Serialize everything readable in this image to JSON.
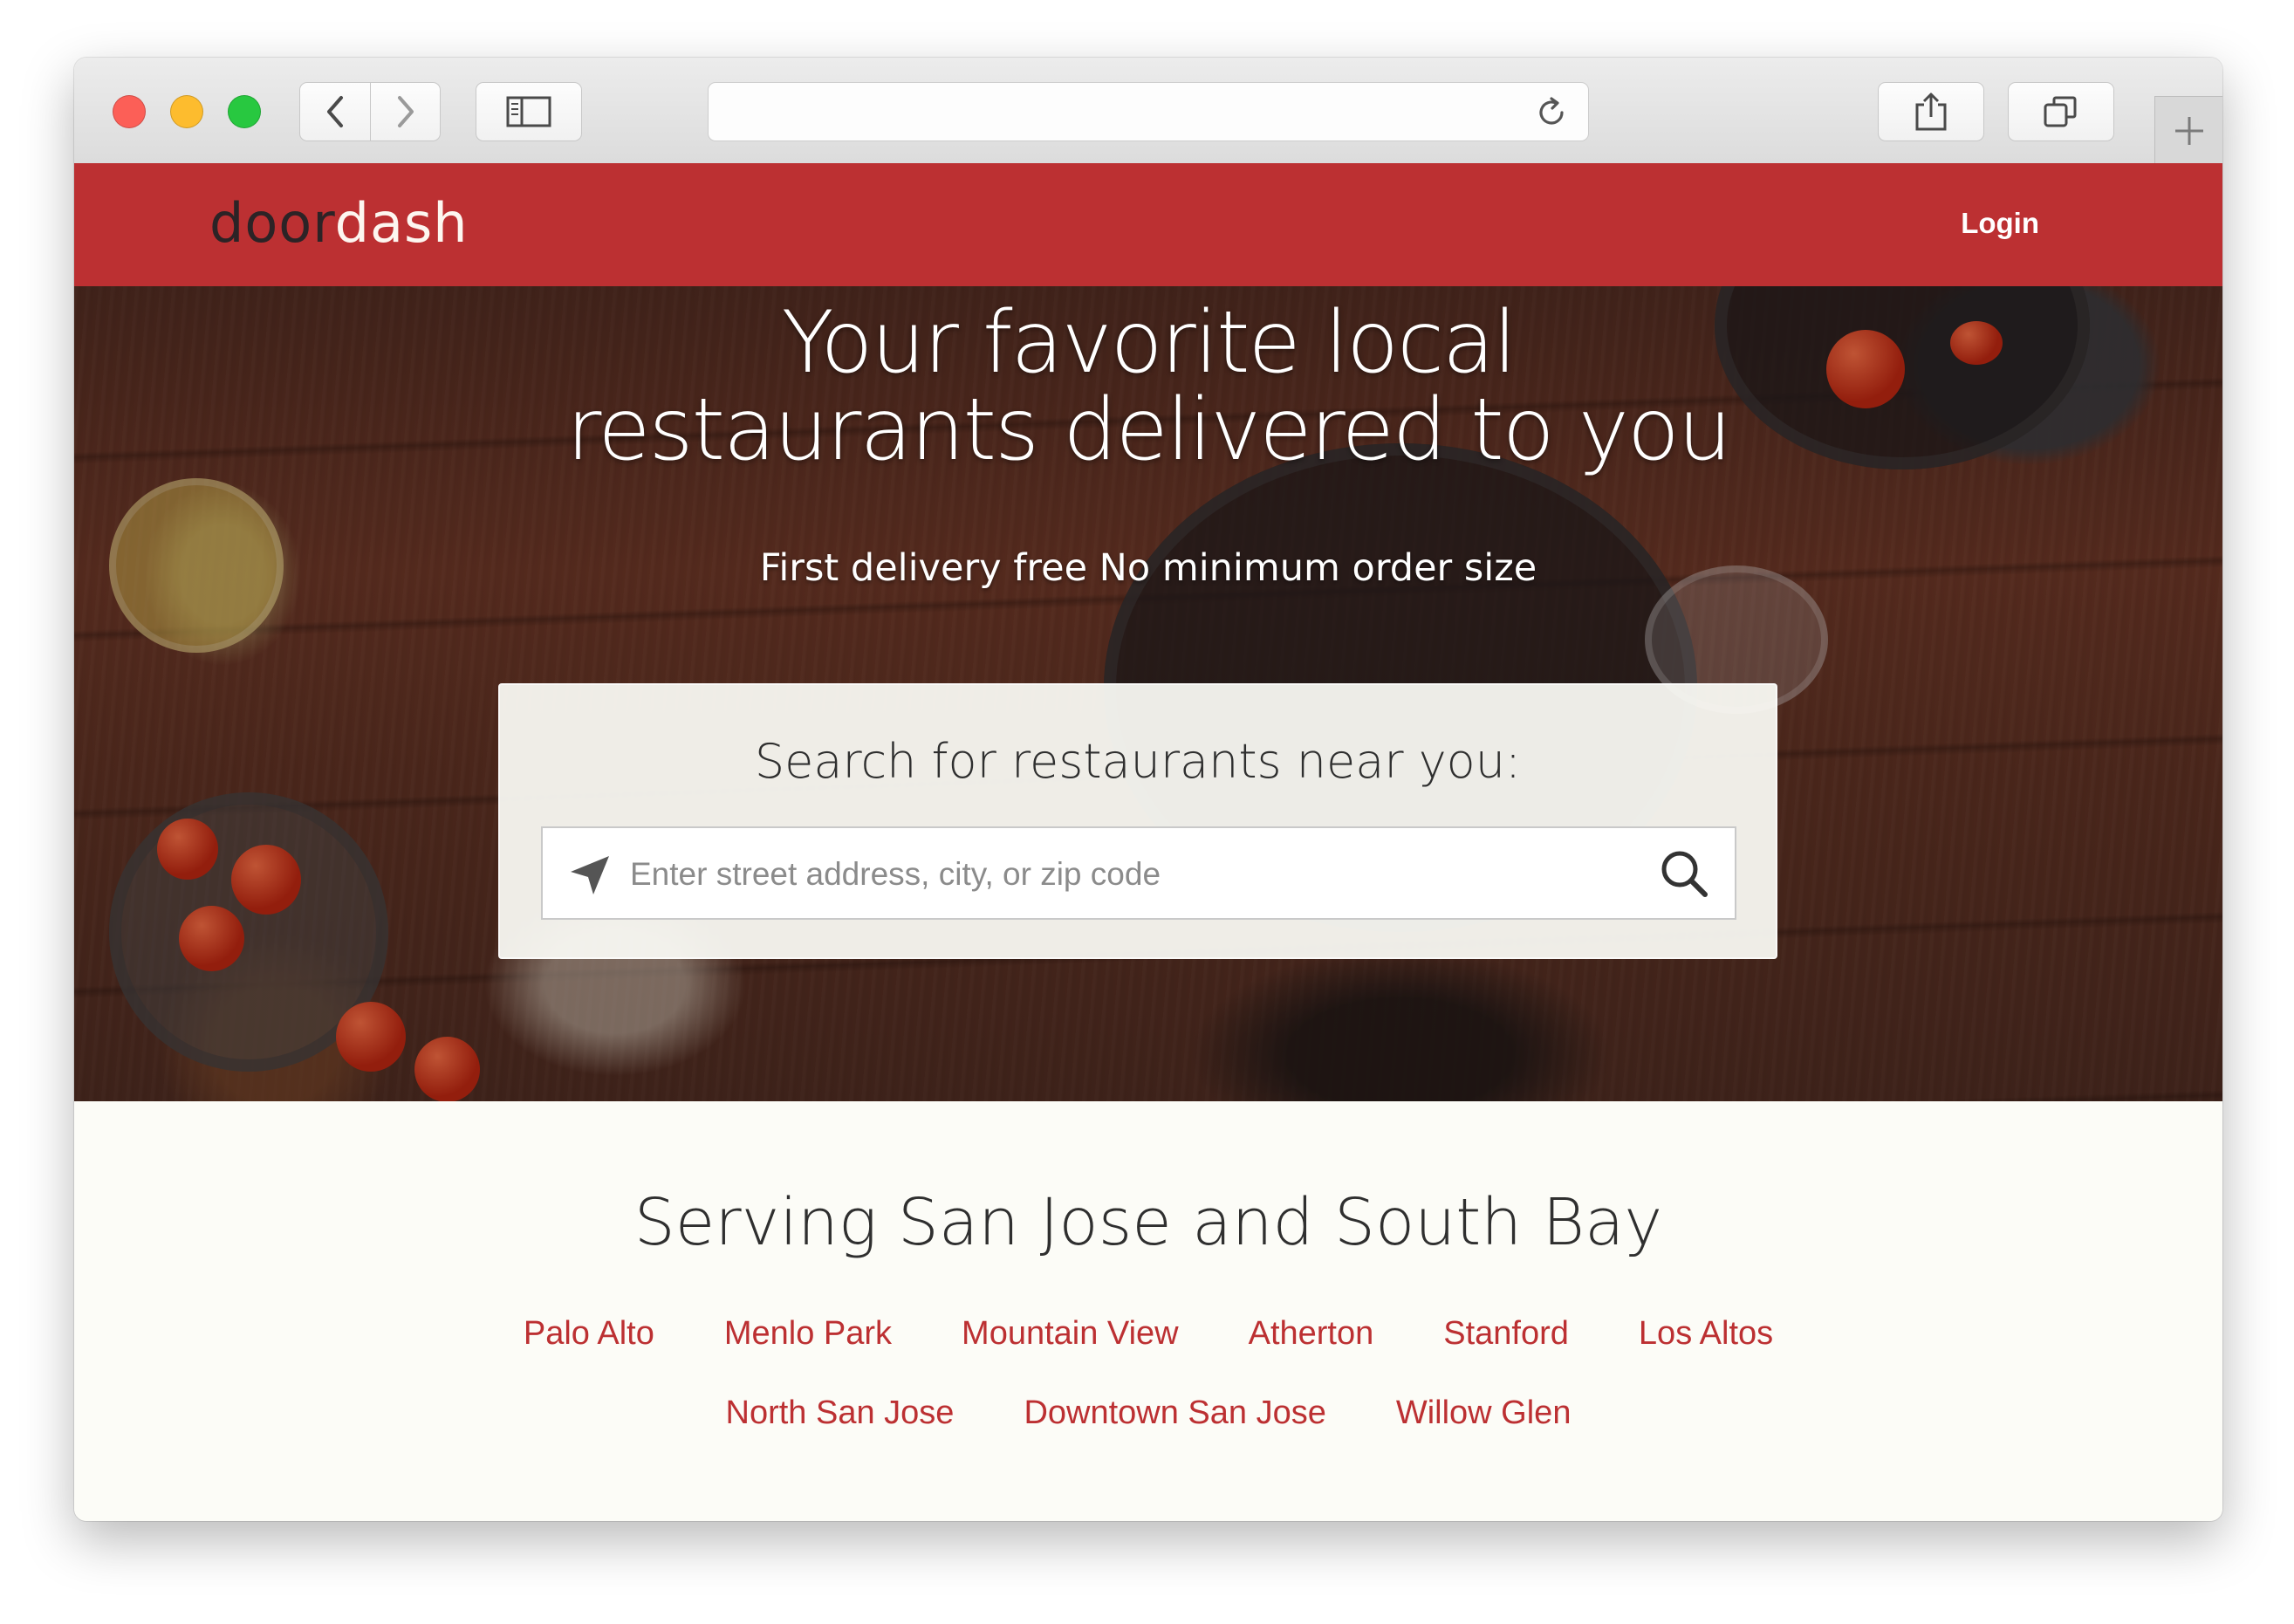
{
  "browser": {
    "address_text": ""
  },
  "header": {
    "logo_part1": "door",
    "logo_part2": "dash",
    "login_label": "Login"
  },
  "hero": {
    "headline_line1": "Your favorite local",
    "headline_line2": "restaurants delivered to you",
    "subheadline": "First delivery free No minimum order size"
  },
  "search": {
    "title": "Search for restaurants near you:",
    "placeholder": "Enter street address, city, or zip code",
    "value": ""
  },
  "serving": {
    "title": "Serving San Jose and South Bay",
    "cities_row1": [
      "Palo Alto",
      "Menlo Park",
      "Mountain View",
      "Atherton",
      "Stanford",
      "Los Altos"
    ],
    "cities_row2": [
      "North San Jose",
      "Downtown San Jose",
      "Willow Glen"
    ]
  },
  "colors": {
    "brand_red": "#bc3032",
    "link_red": "#bc3032",
    "page_bg": "#fcfcf7"
  },
  "icons": {
    "back": "chevron-left-icon",
    "forward": "chevron-right-icon",
    "sidebar": "sidebar-icon",
    "reload": "reload-icon",
    "share": "share-icon",
    "tabs": "tabs-icon",
    "new_tab": "plus-icon",
    "locate": "location-arrow-icon",
    "search": "search-icon"
  }
}
